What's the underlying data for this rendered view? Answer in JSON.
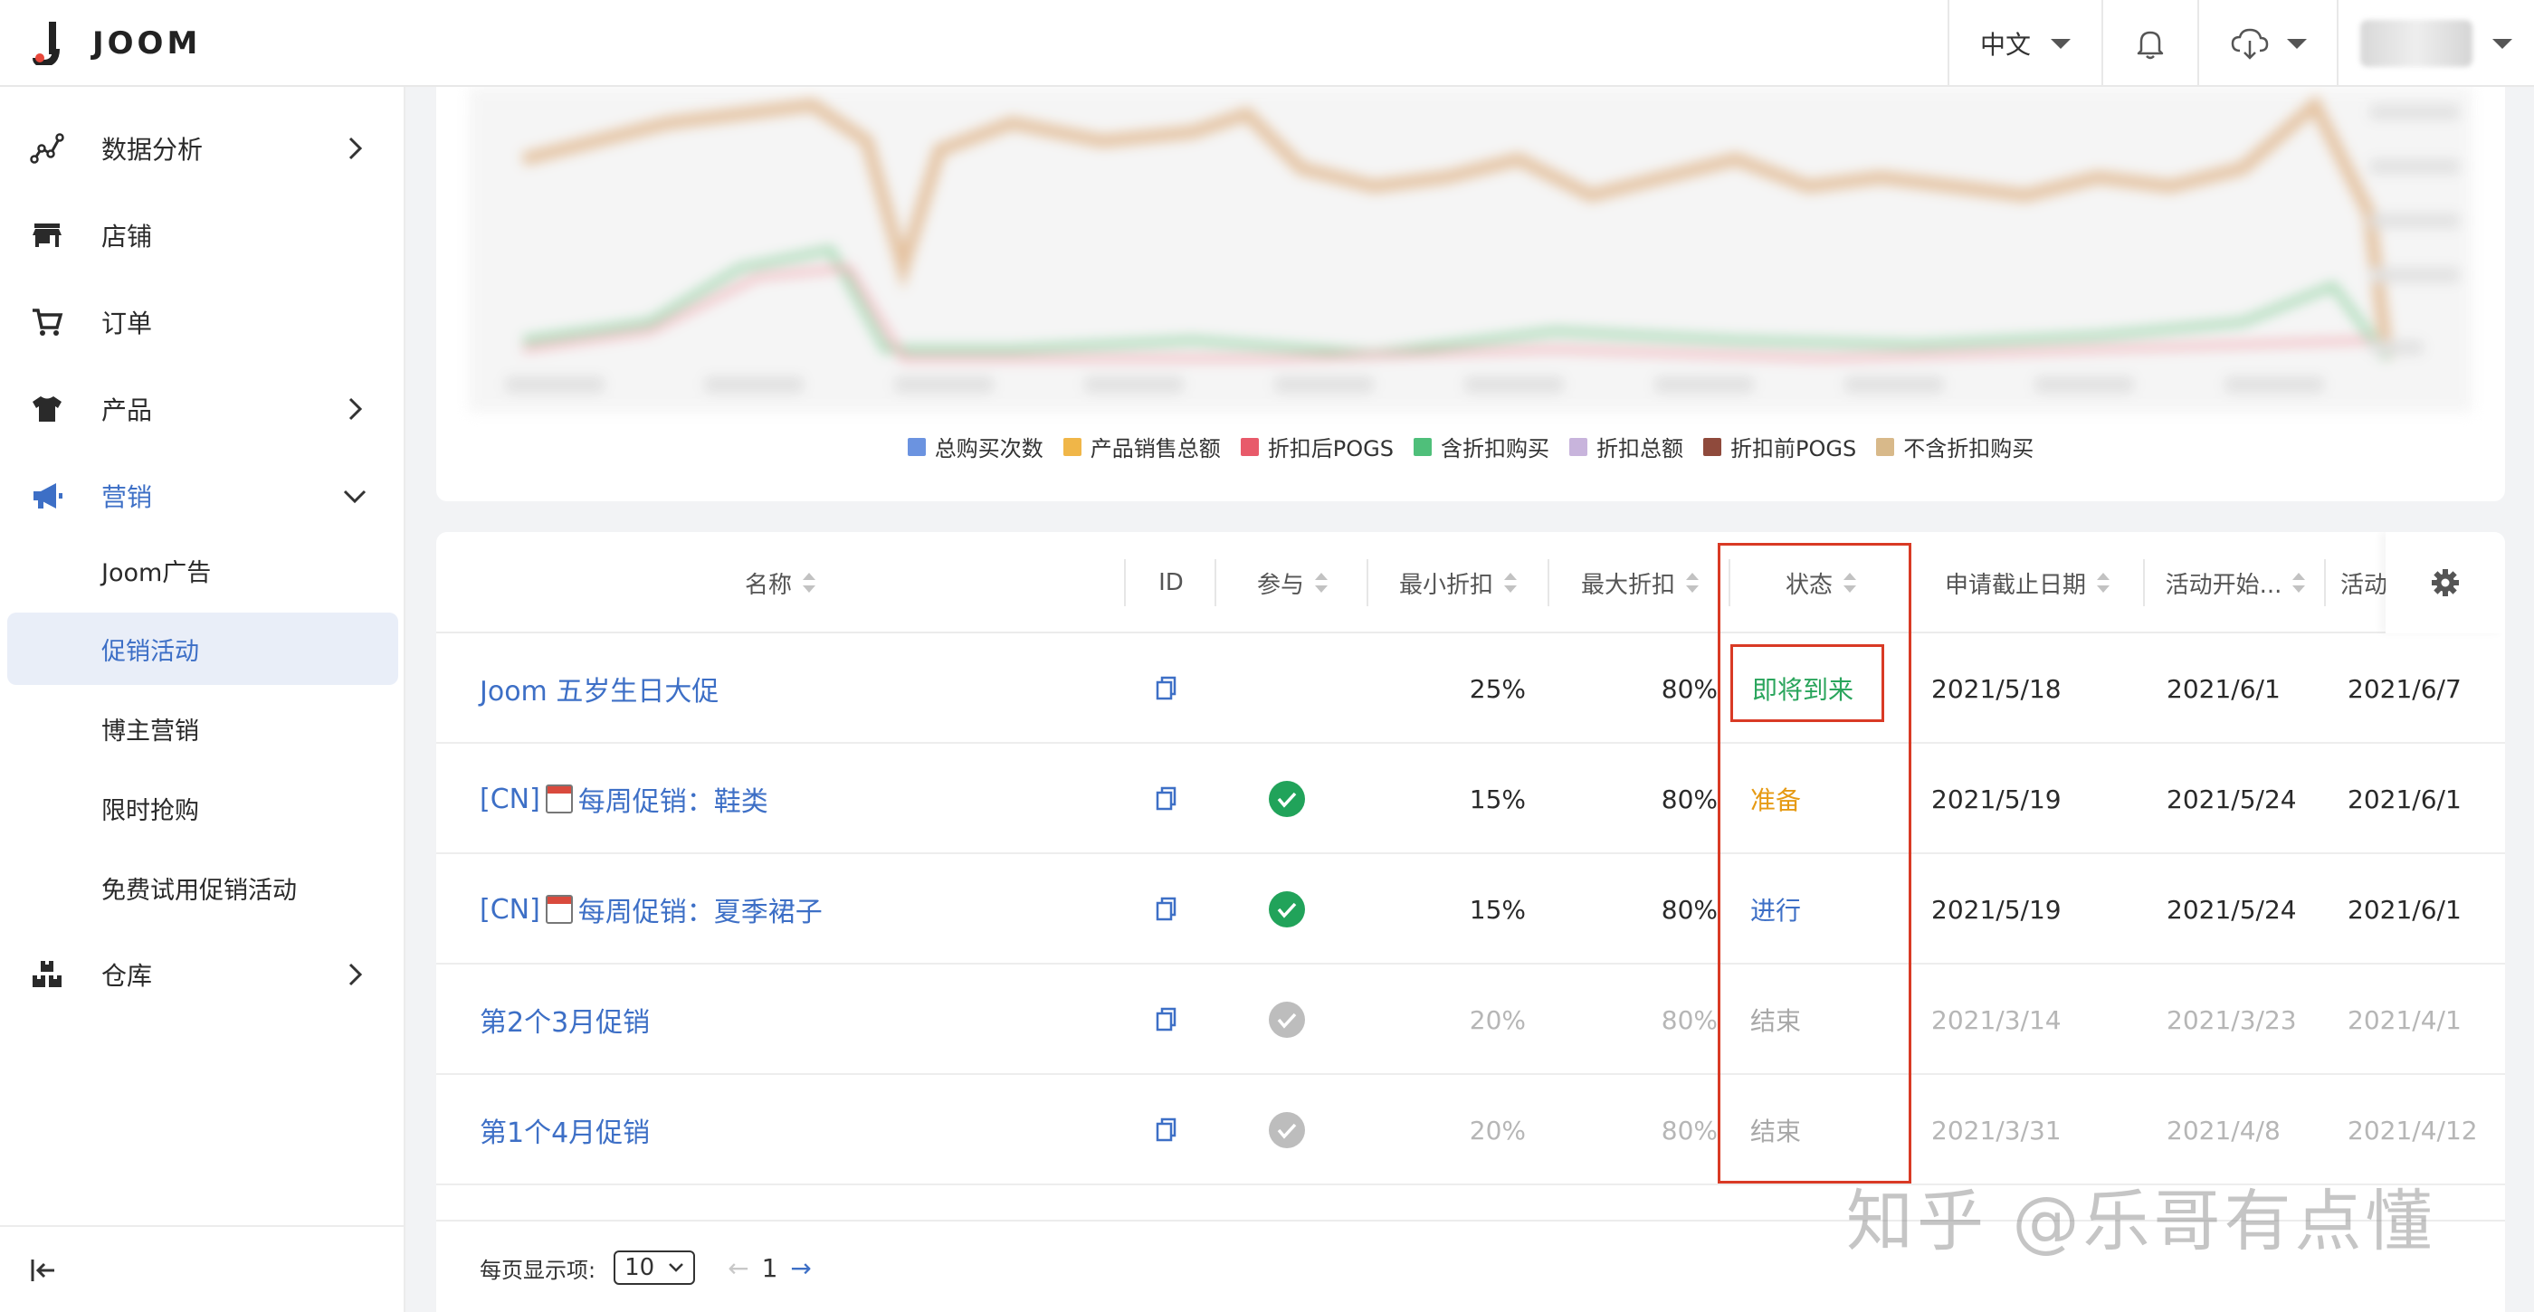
{
  "header": {
    "brand": "JOOM",
    "language": "中文"
  },
  "sidebar": {
    "items": [
      {
        "label": "数据分析"
      },
      {
        "label": "店铺"
      },
      {
        "label": "订单"
      },
      {
        "label": "产品"
      },
      {
        "label": "营销"
      },
      {
        "label": "仓库"
      }
    ],
    "marketing_sub": [
      {
        "label": "Joom广告"
      },
      {
        "label": "促销活动"
      },
      {
        "label": "博主营销"
      },
      {
        "label": "限时抢购"
      },
      {
        "label": "免费试用促销活动"
      }
    ]
  },
  "chart": {
    "legend": [
      {
        "label": "总购买次数",
        "color": "#6b93e0"
      },
      {
        "label": "产品销售总额",
        "color": "#f0b648"
      },
      {
        "label": "折扣后POGS",
        "color": "#e85a6a"
      },
      {
        "label": "含折扣购买",
        "color": "#4fbf7a"
      },
      {
        "label": "折扣总额",
        "color": "#c8b4dc"
      },
      {
        "label": "折扣前POGS",
        "color": "#8f4a3c"
      },
      {
        "label": "不含折扣购买",
        "color": "#d8b98a"
      }
    ]
  },
  "table": {
    "columns": {
      "name": "名称",
      "id": "ID",
      "participate": "参与",
      "min_discount": "最小折扣",
      "max_discount": "最大折扣",
      "status": "状态",
      "deadline": "申请截止日期",
      "start": "活动开始...",
      "end": "活动"
    },
    "rows": [
      {
        "name_pre": "",
        "name": "Joom 五岁生日大促",
        "cal": false,
        "participate": "none",
        "min": "25%",
        "max": "80%",
        "status": "即将到来",
        "status_type": "soon",
        "deadline": "2021/5/18",
        "start": "2021/6/1",
        "end": "2021/6/7",
        "ended": false
      },
      {
        "name_pre": "[CN]",
        "name": "每周促销：鞋类",
        "cal": true,
        "participate": "green",
        "min": "15%",
        "max": "80%",
        "status": "准备",
        "status_type": "prep",
        "deadline": "2021/5/19",
        "start": "2021/5/24",
        "end": "2021/6/1",
        "ended": false
      },
      {
        "name_pre": "[CN]",
        "name": "每周促销：夏季裙子",
        "cal": true,
        "participate": "green",
        "min": "15%",
        "max": "80%",
        "status": "进行",
        "status_type": "run",
        "deadline": "2021/5/19",
        "start": "2021/5/24",
        "end": "2021/6/1",
        "ended": false
      },
      {
        "name_pre": "",
        "name": "第2个3月促销",
        "cal": false,
        "participate": "grey",
        "min": "20%",
        "max": "80%",
        "status": "结束",
        "status_type": "end",
        "deadline": "2021/3/14",
        "start": "2021/3/23",
        "end": "2021/4/1",
        "ended": true
      },
      {
        "name_pre": "",
        "name": "第1个4月促销",
        "cal": false,
        "participate": "grey",
        "min": "20%",
        "max": "80%",
        "status": "结束",
        "status_type": "end",
        "deadline": "2021/3/31",
        "start": "2021/4/8",
        "end": "2021/4/12",
        "ended": true
      }
    ]
  },
  "footer": {
    "per_page_label": "每页显示项:",
    "per_page_value": "10",
    "page": "1"
  },
  "watermark": "知乎 @乐哥有点懂"
}
